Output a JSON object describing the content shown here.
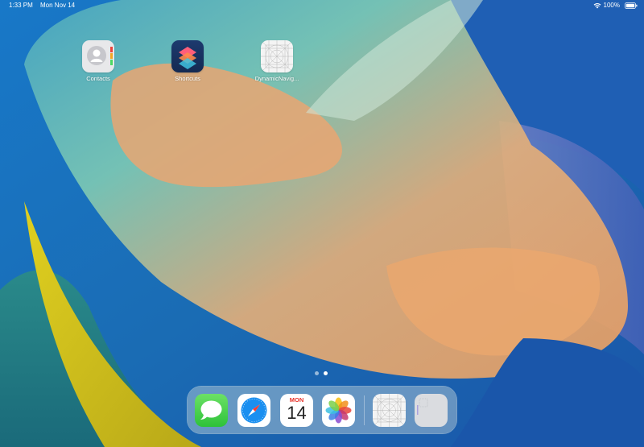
{
  "status_bar": {
    "time": "1:33 PM",
    "date": "Mon Nov 14",
    "battery": "100%",
    "wifi_icon": "wifi-icon",
    "battery_icon": "battery-icon"
  },
  "home_screen": {
    "apps": [
      {
        "label": "Contacts",
        "icon": "contacts-icon"
      },
      {
        "label": "Shortcuts",
        "icon": "shortcuts-icon"
      },
      {
        "label": "DynamicNavig...",
        "icon": "placeholder-grid-icon"
      }
    ],
    "page_count": 2,
    "current_page": 2
  },
  "dock": {
    "apps": [
      {
        "name": "Messages",
        "icon": "messages-icon"
      },
      {
        "name": "Safari",
        "icon": "safari-icon"
      },
      {
        "name": "Calendar",
        "icon": "calendar-icon",
        "month": "MON",
        "day": "14"
      },
      {
        "name": "Photos",
        "icon": "photos-icon"
      }
    ],
    "recent_apps": [
      {
        "name": "DynamicNavig...",
        "icon": "placeholder-grid-icon"
      },
      {
        "name": "App",
        "icon": "blank-app-icon"
      }
    ]
  },
  "colors": {
    "wallpaper_blue": "#1a6fb8",
    "wallpaper_teal": "#6cc4b8",
    "wallpaper_peach": "#e9a870",
    "wallpaper_yellow": "#d9c41a",
    "calendar_red": "#e8332b"
  }
}
